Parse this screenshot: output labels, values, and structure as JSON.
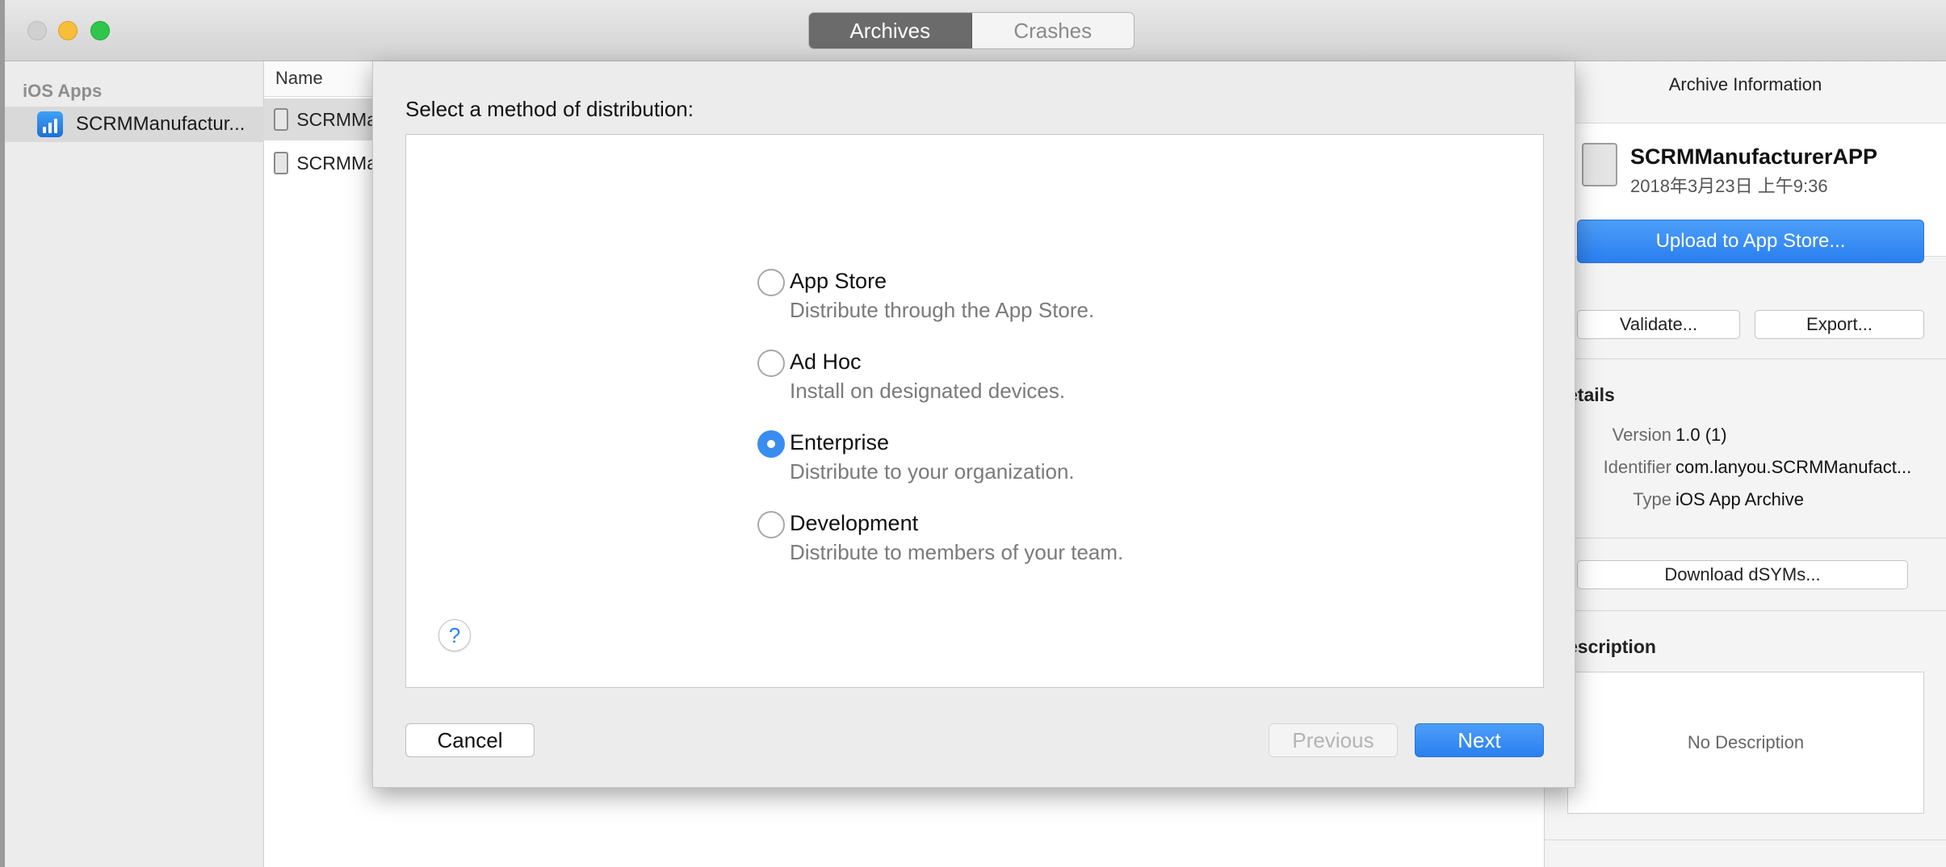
{
  "window": {
    "tabs": [
      {
        "label": "Archives",
        "selected": true
      },
      {
        "label": "Crashes",
        "selected": false
      }
    ]
  },
  "sidebar": {
    "header": "iOS Apps",
    "items": [
      {
        "label": "SCRMManufactur...",
        "icon": "chart-app-icon",
        "selected": true
      }
    ]
  },
  "list": {
    "column_name": "Name",
    "rows": [
      {
        "label": "SCRMMa",
        "selected": true
      },
      {
        "label": "SCRMMa",
        "selected": false
      }
    ]
  },
  "inspector": {
    "title": "Archive Information",
    "archive_name": "SCRMManufacturerAPP",
    "archive_date": "2018年3月23日 上午9:36",
    "upload_button": "Upload to App Store...",
    "validate_button": "Validate...",
    "export_button": "Export...",
    "details_heading": "etails",
    "details": [
      {
        "key": "Version",
        "value": "1.0 (1)"
      },
      {
        "key": "Identifier",
        "value": "com.lanyou.SCRMManufact..."
      },
      {
        "key": "Type",
        "value": "iOS App Archive"
      }
    ],
    "download_dsyms_button": "Download dSYMs...",
    "description_heading": "escription",
    "description_text": "No Description"
  },
  "sheet": {
    "title": "Select a method of distribution:",
    "options": [
      {
        "title": "App Store",
        "description": "Distribute through the App Store.",
        "selected": false
      },
      {
        "title": "Ad Hoc",
        "description": "Install on designated devices.",
        "selected": false
      },
      {
        "title": "Enterprise",
        "description": "Distribute to your organization.",
        "selected": true
      },
      {
        "title": "Development",
        "description": "Distribute to members of your team.",
        "selected": false
      }
    ],
    "help_label": "?",
    "cancel_button": "Cancel",
    "previous_button": "Previous",
    "next_button": "Next"
  },
  "colors": {
    "accent": "#2a7ff0",
    "selected_tab": "#6b6b6b"
  }
}
